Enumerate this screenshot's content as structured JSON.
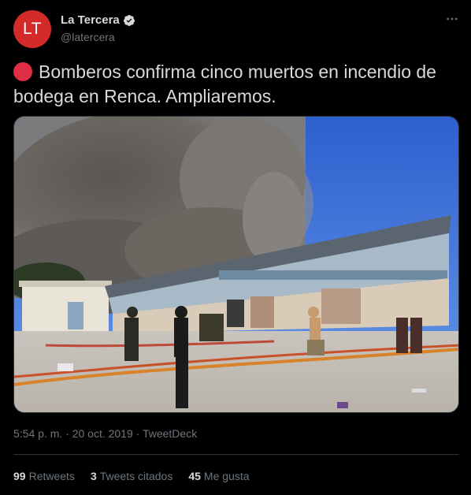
{
  "tweet": {
    "avatar_text": "LT",
    "display_name": "La Tercera",
    "handle": "@latercera",
    "text": "Bomberos confirma cinco muertos en incendio de bodega en Renca. Ampliaremos.",
    "timestamp": "5:54 p. m. · 20 oct. 2019 · TweetDeck",
    "stats": [
      {
        "count": "99",
        "label": "Retweets"
      },
      {
        "count": "3",
        "label": "Tweets citados"
      },
      {
        "count": "45",
        "label": "Me gusta"
      }
    ],
    "icons": {
      "verified": "verified-badge-icon",
      "more": "more-options-icon",
      "emoji": "red-circle-emoji-icon"
    },
    "colors": {
      "background": "#000000",
      "avatar": "#d42a2a",
      "text": "#d9d9d9",
      "muted": "#6e767d",
      "border": "#2f3336",
      "verified": "#d9d9d9"
    }
  }
}
